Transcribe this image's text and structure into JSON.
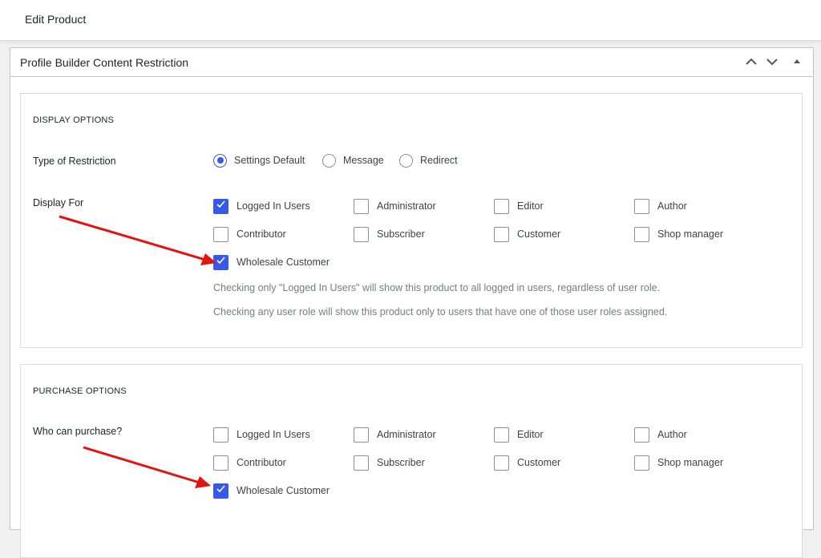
{
  "page": {
    "title": "Edit Product"
  },
  "metabox": {
    "title": "Profile Builder Content Restriction",
    "controls": {
      "up": "chevron-up",
      "down": "chevron-down",
      "toggle": "triangle-up"
    }
  },
  "display_options": {
    "section_title": "DISPLAY OPTIONS",
    "restriction_label": "Type of Restriction",
    "restriction_options": [
      {
        "label": "Settings Default",
        "checked": true
      },
      {
        "label": "Message",
        "checked": false
      },
      {
        "label": "Redirect",
        "checked": false
      }
    ],
    "display_for_label": "Display For",
    "roles": [
      {
        "label": "Logged In Users",
        "checked": true
      },
      {
        "label": "Administrator",
        "checked": false
      },
      {
        "label": "Editor",
        "checked": false
      },
      {
        "label": "Author",
        "checked": false
      },
      {
        "label": "Contributor",
        "checked": false
      },
      {
        "label": "Subscriber",
        "checked": false
      },
      {
        "label": "Customer",
        "checked": false
      },
      {
        "label": "Shop manager",
        "checked": false
      },
      {
        "label": "Wholesale Customer",
        "checked": true
      }
    ],
    "help_1": "Checking only \"Logged In Users\" will show this product to all logged in users, regardless of user role.",
    "help_2": "Checking any user role will show this product only to users that have one of those user roles assigned."
  },
  "purchase_options": {
    "section_title": "PURCHASE OPTIONS",
    "who_label": "Who can purchase?",
    "roles": [
      {
        "label": "Logged In Users",
        "checked": false
      },
      {
        "label": "Administrator",
        "checked": false
      },
      {
        "label": "Editor",
        "checked": false
      },
      {
        "label": "Author",
        "checked": false
      },
      {
        "label": "Contributor",
        "checked": false
      },
      {
        "label": "Subscriber",
        "checked": false
      },
      {
        "label": "Customer",
        "checked": false
      },
      {
        "label": "Shop manager",
        "checked": false
      },
      {
        "label": "Wholesale Customer",
        "checked": true
      }
    ]
  },
  "colors": {
    "accent": "#3858e9",
    "annotation_arrow": "#e3130f"
  }
}
